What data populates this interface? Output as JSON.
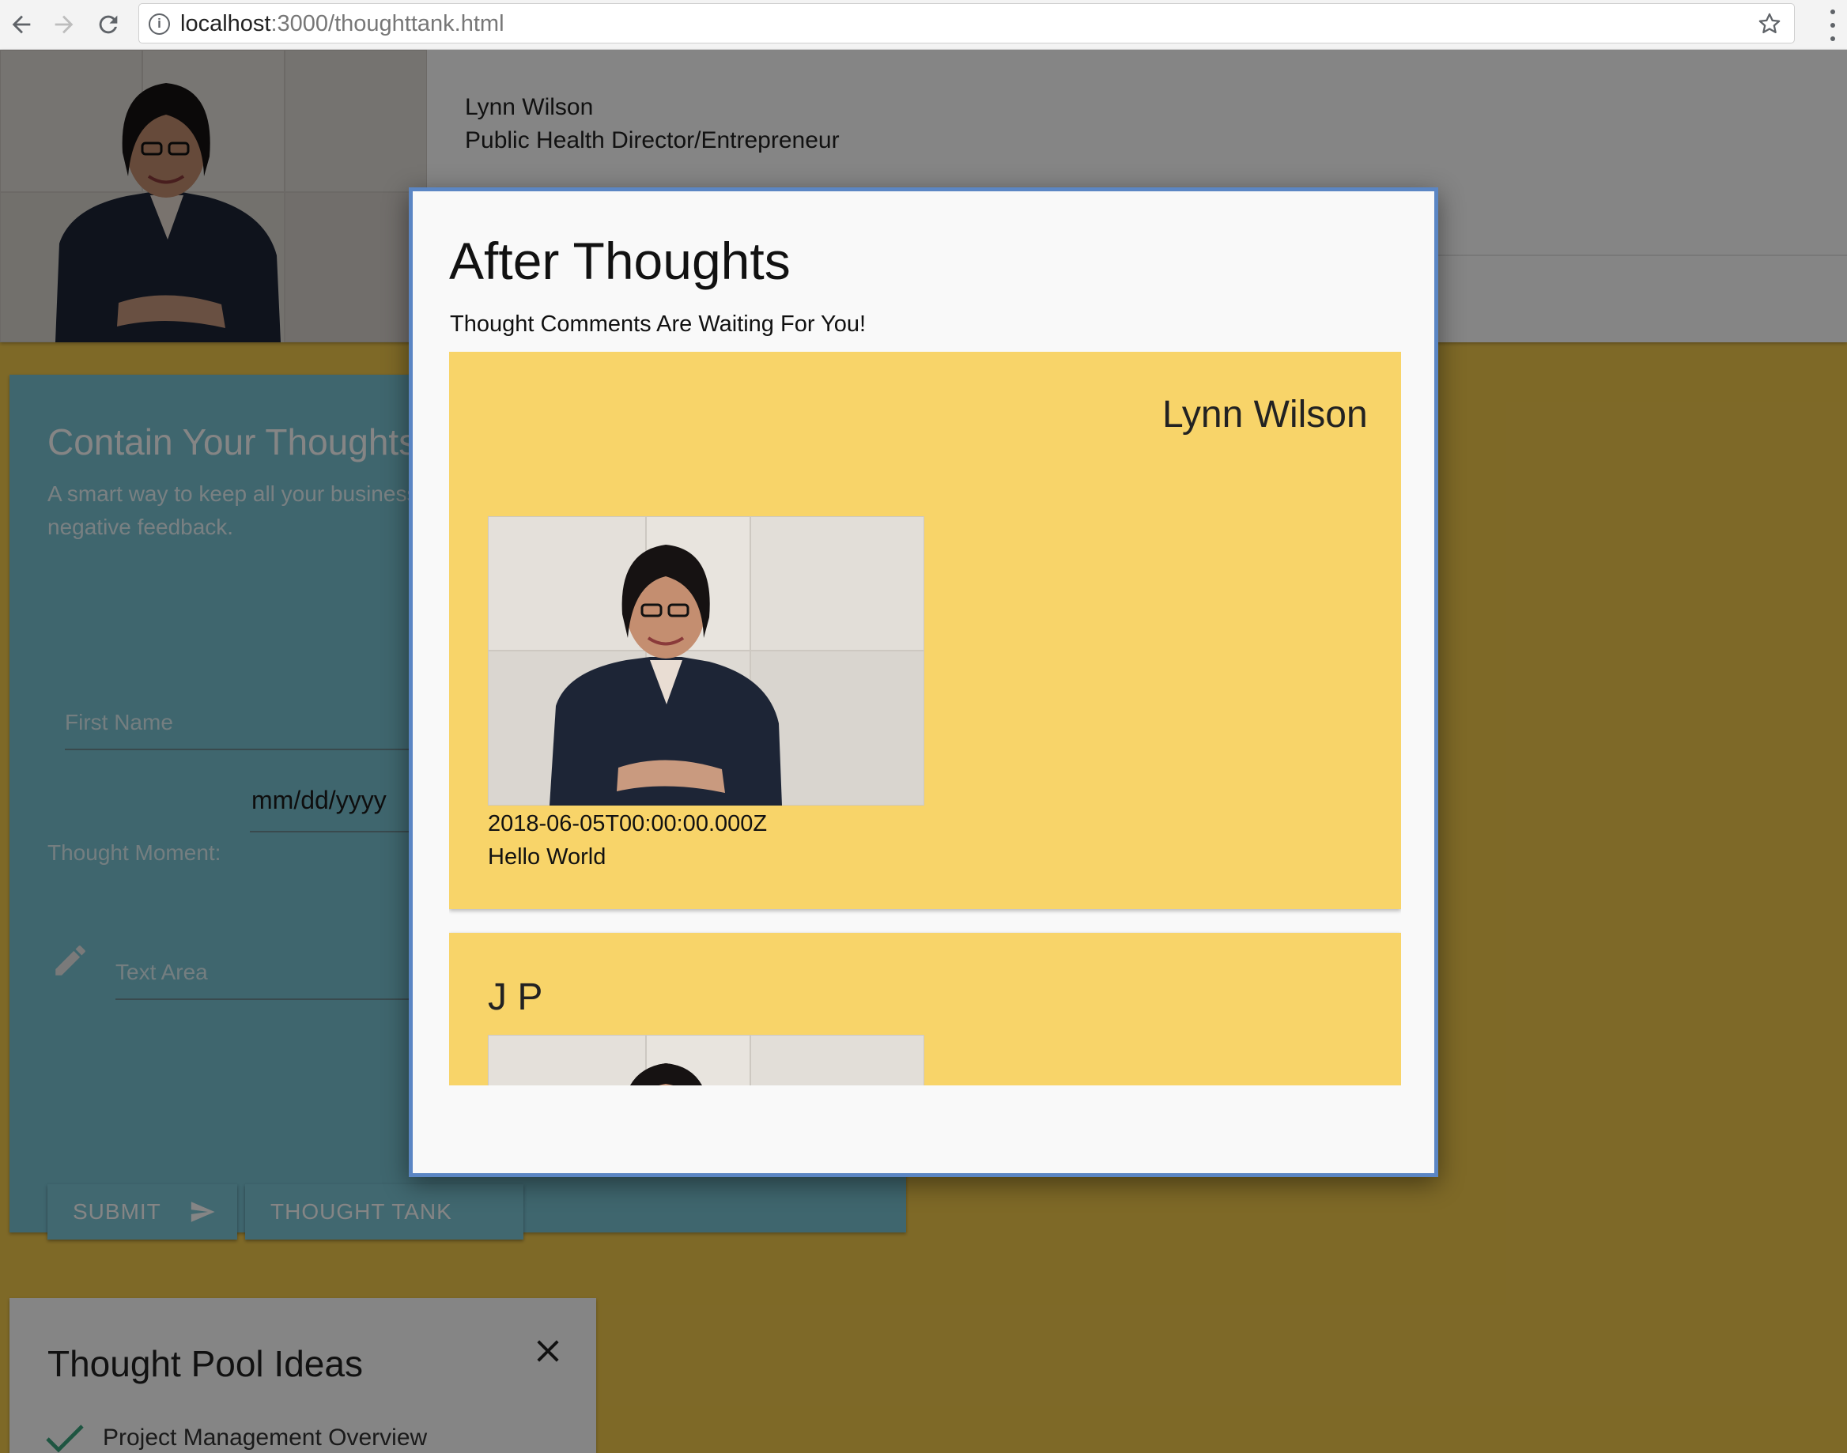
{
  "browser": {
    "url_host": "localhost",
    "url_path": ":3000/thoughttank.html"
  },
  "header": {
    "name": "Lynn Wilson",
    "role": "Public Health Director/Entrepreneur"
  },
  "form_card": {
    "title": "Contain Your Thoughts",
    "subtitle": "A smart way to keep all your business ideas without negative feedback.",
    "first_name_placeholder": "First Name",
    "thought_moment_label": "Thought Moment:",
    "date_value": "mm/dd/yyyy",
    "text_area_placeholder": "Text Area",
    "submit_label": "SUBMIT",
    "thought_tank_label": "THOUGHT TANK"
  },
  "pool_card": {
    "title": "Thought Pool Ideas",
    "items": [
      "Project Management Overview"
    ]
  },
  "modal": {
    "title": "After Thoughts",
    "subtitle": "Thought Comments Are Waiting For You!",
    "comments": [
      {
        "name": "Lynn Wilson",
        "date": "2018-06-05T00:00:00.000Z",
        "text": "Hello World"
      },
      {
        "name": "J P"
      }
    ]
  },
  "colors": {
    "page_background": "#f2c94c",
    "form_card": "#79c3d3",
    "comment_card": "#f8d469",
    "modal_border": "#5b86c4"
  }
}
